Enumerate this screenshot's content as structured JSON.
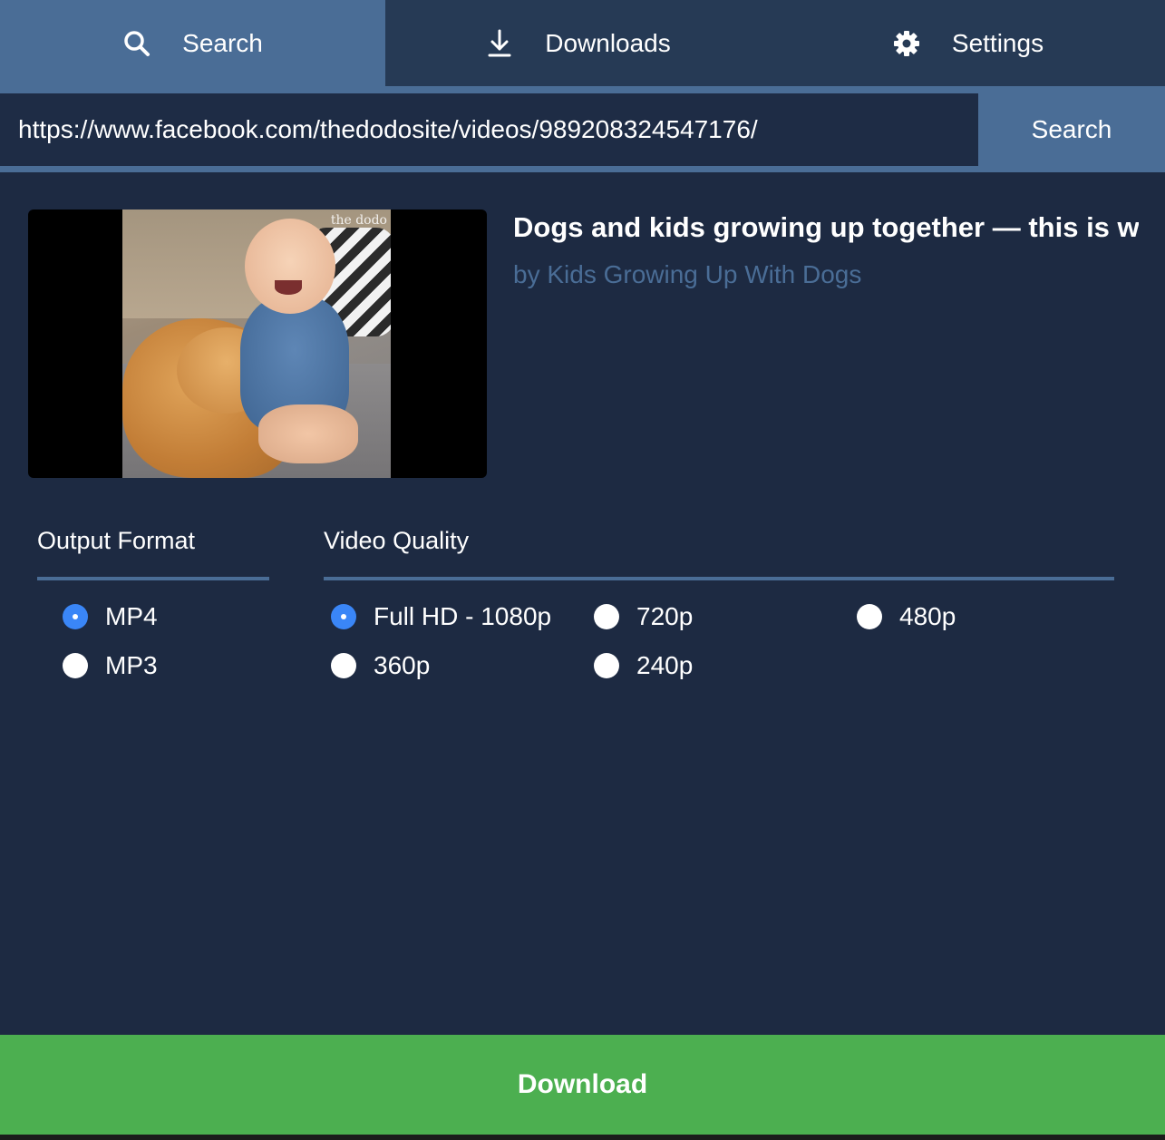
{
  "tabs": {
    "search": {
      "label": "Search",
      "icon": "search-icon"
    },
    "downloads": {
      "label": "Downloads",
      "icon": "download-icon"
    },
    "settings": {
      "label": "Settings",
      "icon": "gear-icon"
    }
  },
  "search_bar": {
    "url_value": "https://www.facebook.com/thedodosite/videos/989208324547176/",
    "button_label": "Search"
  },
  "video": {
    "title": "Dogs and kids growing up together — this is w...",
    "author": "by Kids Growing Up With Dogs",
    "thumbnail_watermark": "the dodo"
  },
  "output_format": {
    "label": "Output Format",
    "options": [
      {
        "label": "MP4",
        "selected": true
      },
      {
        "label": "MP3",
        "selected": false
      }
    ]
  },
  "video_quality": {
    "label": "Video Quality",
    "options": [
      {
        "label": "Full HD - 1080p",
        "selected": true
      },
      {
        "label": "720p",
        "selected": false
      },
      {
        "label": "480p",
        "selected": false
      },
      {
        "label": "360p",
        "selected": false
      },
      {
        "label": "240p",
        "selected": false
      }
    ]
  },
  "download_button": {
    "label": "Download"
  },
  "colors": {
    "background": "#1d2a42",
    "tab_bar": "#263a55",
    "accent": "#4a6d96",
    "radio_selected": "#3a86f7",
    "download": "#4caf50"
  }
}
